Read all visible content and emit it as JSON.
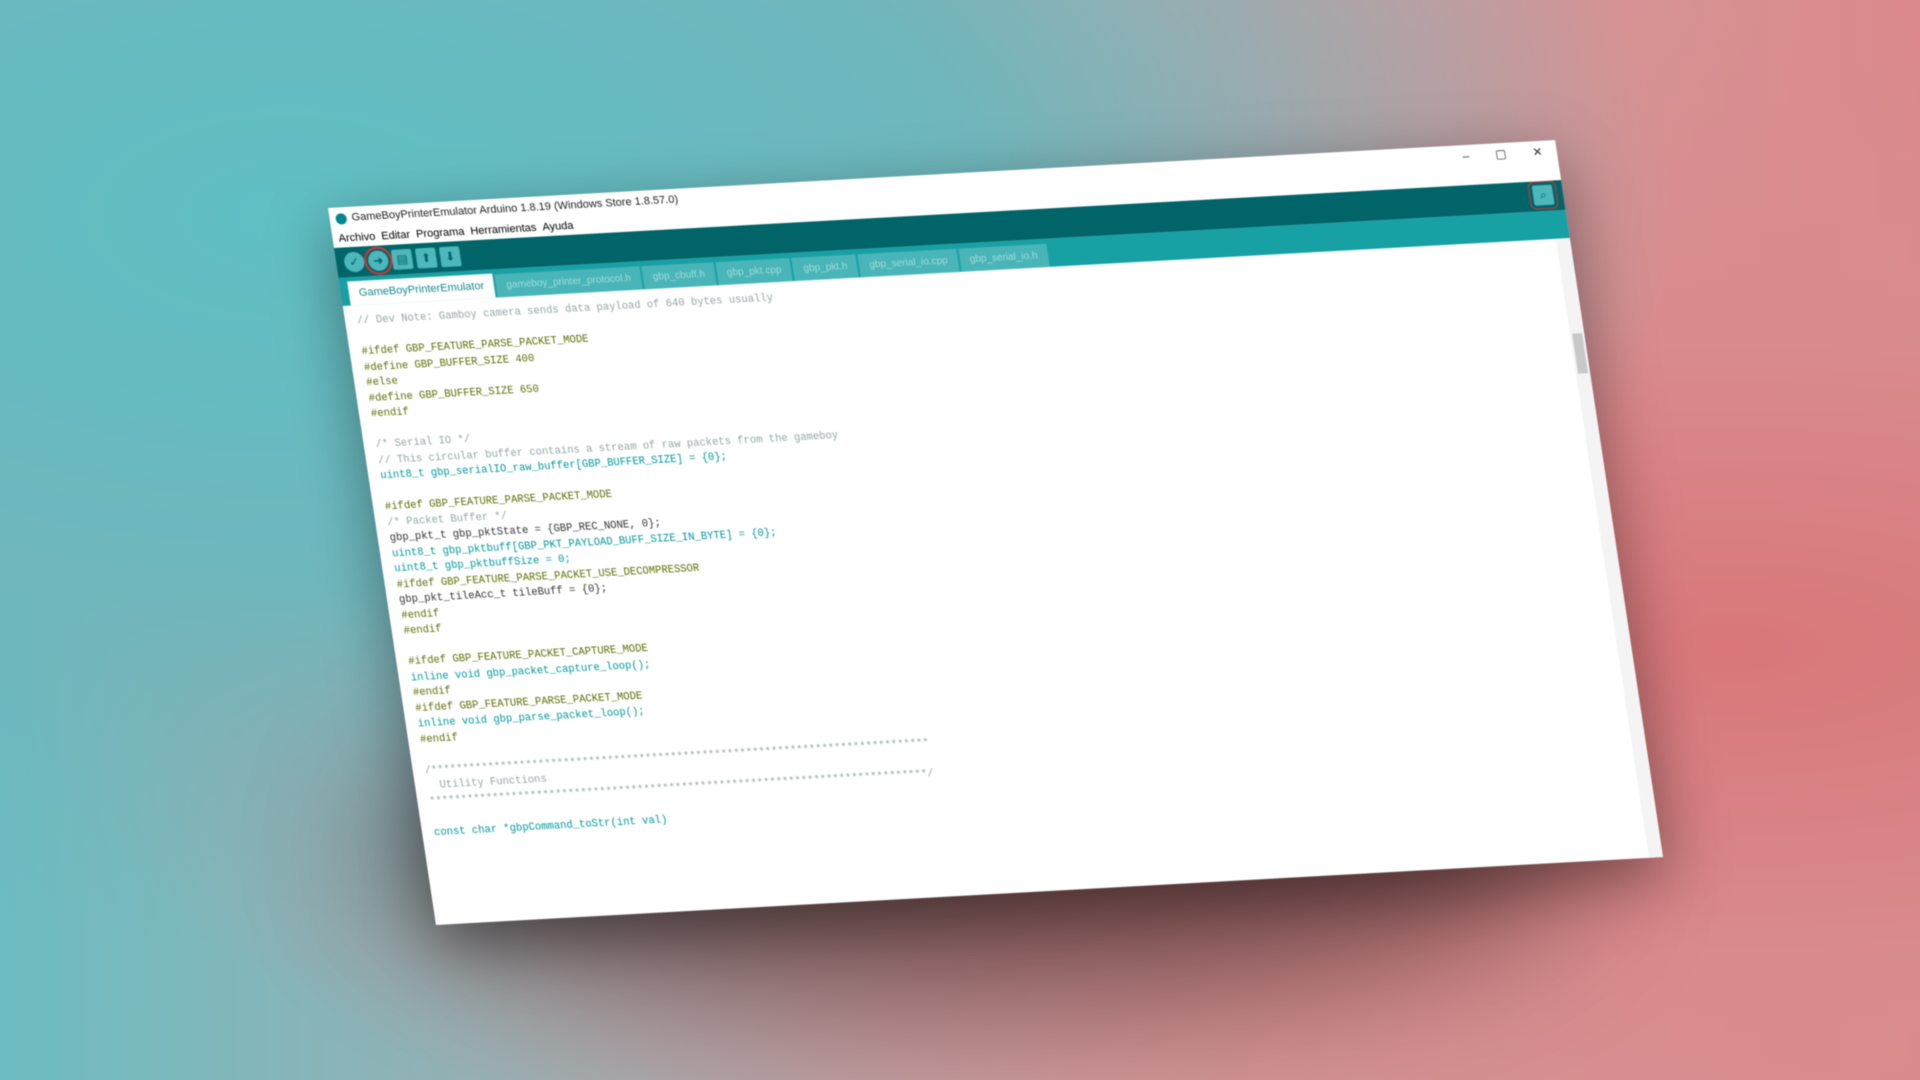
{
  "window": {
    "title": "GameBoyPrinterEmulator Arduino 1.8.19 (Windows Store 1.8.57.0)",
    "minimize": "–",
    "maximize": "▢",
    "close": "✕"
  },
  "menu": [
    "Archivo",
    "Editar",
    "Programa",
    "Herramientas",
    "Ayuda"
  ],
  "toolbar": {
    "verify": "✓",
    "upload": "➜",
    "new": "▤",
    "open": "⬆",
    "save": "⬇",
    "serial_monitor": "⌕"
  },
  "tabs": [
    "GameBoyPrinterEmulator",
    "gameboy_printer_protocol.h",
    "gbp_cbuff.h",
    "gbp_pkt.cpp",
    "gbp_pkt.h",
    "gbp_serial_io.cpp",
    "gbp_serial_io.h"
  ],
  "code": [
    {
      "t": "// Dev Note: Gamboy camera sends data payload of 640 bytes usually",
      "c": "cm"
    },
    {
      "t": "",
      "c": ""
    },
    {
      "t": "#ifdef GBP_FEATURE_PARSE_PACKET_MODE",
      "c": "pp"
    },
    {
      "t": "#define GBP_BUFFER_SIZE 400",
      "c": "pp"
    },
    {
      "t": "#else",
      "c": "pp"
    },
    {
      "t": "#define GBP_BUFFER_SIZE 650",
      "c": "pp"
    },
    {
      "t": "#endif",
      "c": "pp"
    },
    {
      "t": "",
      "c": ""
    },
    {
      "t": "/* Serial IO */",
      "c": "cm"
    },
    {
      "t": "// This circular buffer contains a stream of raw packets from the gameboy",
      "c": "cm"
    },
    {
      "t": "uint8_t gbp_serialIO_raw_buffer[GBP_BUFFER_SIZE] = {0};",
      "c": "kw"
    },
    {
      "t": "",
      "c": ""
    },
    {
      "t": "#ifdef GBP_FEATURE_PARSE_PACKET_MODE",
      "c": "pp"
    },
    {
      "t": "/* Packet Buffer */",
      "c": "cm"
    },
    {
      "t": "gbp_pkt_t gbp_pktState = {GBP_REC_NONE, 0};",
      "c": ""
    },
    {
      "t": "uint8_t gbp_pktbuff[GBP_PKT_PAYLOAD_BUFF_SIZE_IN_BYTE] = {0};",
      "c": "kw"
    },
    {
      "t": "uint8_t gbp_pktbuffSize = 0;",
      "c": "kw"
    },
    {
      "t": "#ifdef GBP_FEATURE_PARSE_PACKET_USE_DECOMPRESSOR",
      "c": "pp"
    },
    {
      "t": "gbp_pkt_tileAcc_t tileBuff = {0};",
      "c": ""
    },
    {
      "t": "#endif",
      "c": "pp"
    },
    {
      "t": "#endif",
      "c": "pp"
    },
    {
      "t": "",
      "c": ""
    },
    {
      "t": "#ifdef GBP_FEATURE_PACKET_CAPTURE_MODE",
      "c": "pp"
    },
    {
      "t": "inline void gbp_packet_capture_loop();",
      "c": "kw"
    },
    {
      "t": "#endif",
      "c": "pp"
    },
    {
      "t": "#ifdef GBP_FEATURE_PARSE_PACKET_MODE",
      "c": "pp"
    },
    {
      "t": "inline void gbp_parse_packet_loop();",
      "c": "kw"
    },
    {
      "t": "#endif",
      "c": "pp"
    },
    {
      "t": "",
      "c": ""
    },
    {
      "t": "/*******************************************************************************",
      "c": "cm"
    },
    {
      "t": "  Utility Functions",
      "c": "cm"
    },
    {
      "t": "*******************************************************************************/",
      "c": "cm"
    },
    {
      "t": "",
      "c": ""
    },
    {
      "t": "const char *gbpCommand_toStr(int val)",
      "c": "kw"
    }
  ]
}
